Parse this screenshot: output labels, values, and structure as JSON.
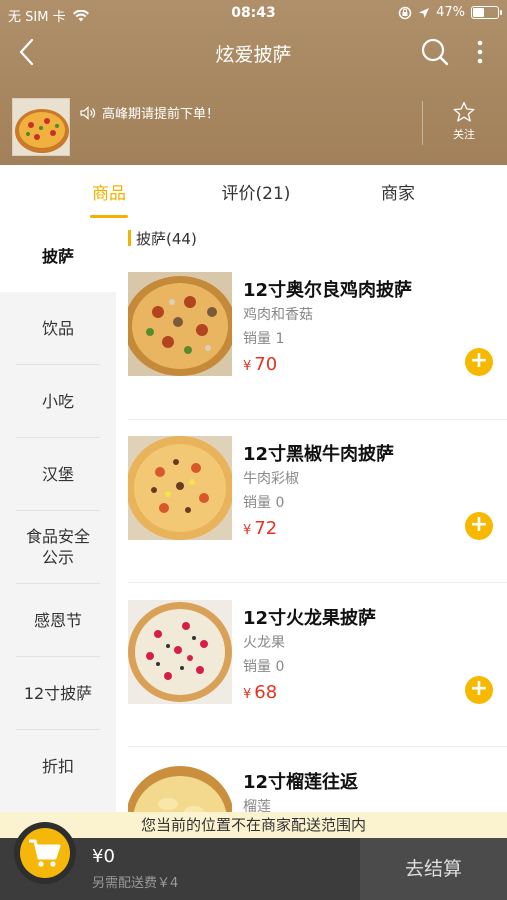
{
  "status_bar": {
    "carrier": "无 SIM 卡",
    "time": "08:43",
    "battery": "47%",
    "battery_level": 0.47
  },
  "nav": {
    "title": "炫爱披萨"
  },
  "store": {
    "notice": "高峰期请提前下单！",
    "follow_label": "关注"
  },
  "tabs": [
    {
      "label": "商品",
      "active": true
    },
    {
      "label": "评价(21)",
      "active": false
    },
    {
      "label": "商家",
      "active": false
    }
  ],
  "sidebar": {
    "items": [
      {
        "label": "披萨",
        "active": true
      },
      {
        "label": "饮品"
      },
      {
        "label": "小吃"
      },
      {
        "label": "汉堡"
      },
      {
        "label": "食品安全\n公示"
      },
      {
        "label": "感恩节"
      },
      {
        "label": "12寸披萨"
      },
      {
        "label": "折扣"
      }
    ]
  },
  "category": {
    "title": "披萨(44)"
  },
  "products": [
    {
      "name": "12寸奥尔良鸡肉披萨",
      "desc": "鸡肉和香菇",
      "sales": "销量 1",
      "currency": "¥",
      "price": "70"
    },
    {
      "name": "12寸黑椒牛肉披萨",
      "desc": "牛肉彩椒",
      "sales": "销量 0",
      "currency": "¥",
      "price": "72"
    },
    {
      "name": "12寸火龙果披萨",
      "desc": "火龙果",
      "sales": "销量 0",
      "currency": "¥",
      "price": "68"
    },
    {
      "name": "12寸榴莲往返",
      "desc": "榴莲",
      "sales": "",
      "currency": "",
      "price": ""
    }
  ],
  "add_button_label": "+",
  "bottom": {
    "warning": "您当前的位置不在商家配送范围内",
    "amount": "¥0",
    "delivery_fee": "另需配送费￥4",
    "checkout_label": "去结算"
  },
  "colors": {
    "accent": "#f2b200",
    "price": "#e8321f",
    "header_bg": "#a98962"
  }
}
